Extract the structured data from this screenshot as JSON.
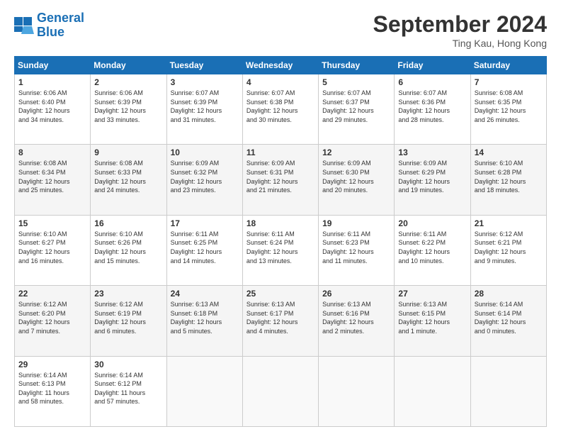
{
  "header": {
    "logo_line1": "General",
    "logo_line2": "Blue",
    "month_title": "September 2024",
    "location": "Ting Kau, Hong Kong"
  },
  "calendar": {
    "days_of_week": [
      "Sunday",
      "Monday",
      "Tuesday",
      "Wednesday",
      "Thursday",
      "Friday",
      "Saturday"
    ],
    "weeks": [
      [
        {
          "day": "1",
          "info": "Sunrise: 6:06 AM\nSunset: 6:40 PM\nDaylight: 12 hours\nand 34 minutes."
        },
        {
          "day": "2",
          "info": "Sunrise: 6:06 AM\nSunset: 6:39 PM\nDaylight: 12 hours\nand 33 minutes."
        },
        {
          "day": "3",
          "info": "Sunrise: 6:07 AM\nSunset: 6:39 PM\nDaylight: 12 hours\nand 31 minutes."
        },
        {
          "day": "4",
          "info": "Sunrise: 6:07 AM\nSunset: 6:38 PM\nDaylight: 12 hours\nand 30 minutes."
        },
        {
          "day": "5",
          "info": "Sunrise: 6:07 AM\nSunset: 6:37 PM\nDaylight: 12 hours\nand 29 minutes."
        },
        {
          "day": "6",
          "info": "Sunrise: 6:07 AM\nSunset: 6:36 PM\nDaylight: 12 hours\nand 28 minutes."
        },
        {
          "day": "7",
          "info": "Sunrise: 6:08 AM\nSunset: 6:35 PM\nDaylight: 12 hours\nand 26 minutes."
        }
      ],
      [
        {
          "day": "8",
          "info": "Sunrise: 6:08 AM\nSunset: 6:34 PM\nDaylight: 12 hours\nand 25 minutes."
        },
        {
          "day": "9",
          "info": "Sunrise: 6:08 AM\nSunset: 6:33 PM\nDaylight: 12 hours\nand 24 minutes."
        },
        {
          "day": "10",
          "info": "Sunrise: 6:09 AM\nSunset: 6:32 PM\nDaylight: 12 hours\nand 23 minutes."
        },
        {
          "day": "11",
          "info": "Sunrise: 6:09 AM\nSunset: 6:31 PM\nDaylight: 12 hours\nand 21 minutes."
        },
        {
          "day": "12",
          "info": "Sunrise: 6:09 AM\nSunset: 6:30 PM\nDaylight: 12 hours\nand 20 minutes."
        },
        {
          "day": "13",
          "info": "Sunrise: 6:09 AM\nSunset: 6:29 PM\nDaylight: 12 hours\nand 19 minutes."
        },
        {
          "day": "14",
          "info": "Sunrise: 6:10 AM\nSunset: 6:28 PM\nDaylight: 12 hours\nand 18 minutes."
        }
      ],
      [
        {
          "day": "15",
          "info": "Sunrise: 6:10 AM\nSunset: 6:27 PM\nDaylight: 12 hours\nand 16 minutes."
        },
        {
          "day": "16",
          "info": "Sunrise: 6:10 AM\nSunset: 6:26 PM\nDaylight: 12 hours\nand 15 minutes."
        },
        {
          "day": "17",
          "info": "Sunrise: 6:11 AM\nSunset: 6:25 PM\nDaylight: 12 hours\nand 14 minutes."
        },
        {
          "day": "18",
          "info": "Sunrise: 6:11 AM\nSunset: 6:24 PM\nDaylight: 12 hours\nand 13 minutes."
        },
        {
          "day": "19",
          "info": "Sunrise: 6:11 AM\nSunset: 6:23 PM\nDaylight: 12 hours\nand 11 minutes."
        },
        {
          "day": "20",
          "info": "Sunrise: 6:11 AM\nSunset: 6:22 PM\nDaylight: 12 hours\nand 10 minutes."
        },
        {
          "day": "21",
          "info": "Sunrise: 6:12 AM\nSunset: 6:21 PM\nDaylight: 12 hours\nand 9 minutes."
        }
      ],
      [
        {
          "day": "22",
          "info": "Sunrise: 6:12 AM\nSunset: 6:20 PM\nDaylight: 12 hours\nand 7 minutes."
        },
        {
          "day": "23",
          "info": "Sunrise: 6:12 AM\nSunset: 6:19 PM\nDaylight: 12 hours\nand 6 minutes."
        },
        {
          "day": "24",
          "info": "Sunrise: 6:13 AM\nSunset: 6:18 PM\nDaylight: 12 hours\nand 5 minutes."
        },
        {
          "day": "25",
          "info": "Sunrise: 6:13 AM\nSunset: 6:17 PM\nDaylight: 12 hours\nand 4 minutes."
        },
        {
          "day": "26",
          "info": "Sunrise: 6:13 AM\nSunset: 6:16 PM\nDaylight: 12 hours\nand 2 minutes."
        },
        {
          "day": "27",
          "info": "Sunrise: 6:13 AM\nSunset: 6:15 PM\nDaylight: 12 hours\nand 1 minute."
        },
        {
          "day": "28",
          "info": "Sunrise: 6:14 AM\nSunset: 6:14 PM\nDaylight: 12 hours\nand 0 minutes."
        }
      ],
      [
        {
          "day": "29",
          "info": "Sunrise: 6:14 AM\nSunset: 6:13 PM\nDaylight: 11 hours\nand 58 minutes."
        },
        {
          "day": "30",
          "info": "Sunrise: 6:14 AM\nSunset: 6:12 PM\nDaylight: 11 hours\nand 57 minutes."
        },
        {
          "day": "",
          "info": ""
        },
        {
          "day": "",
          "info": ""
        },
        {
          "day": "",
          "info": ""
        },
        {
          "day": "",
          "info": ""
        },
        {
          "day": "",
          "info": ""
        }
      ]
    ]
  }
}
